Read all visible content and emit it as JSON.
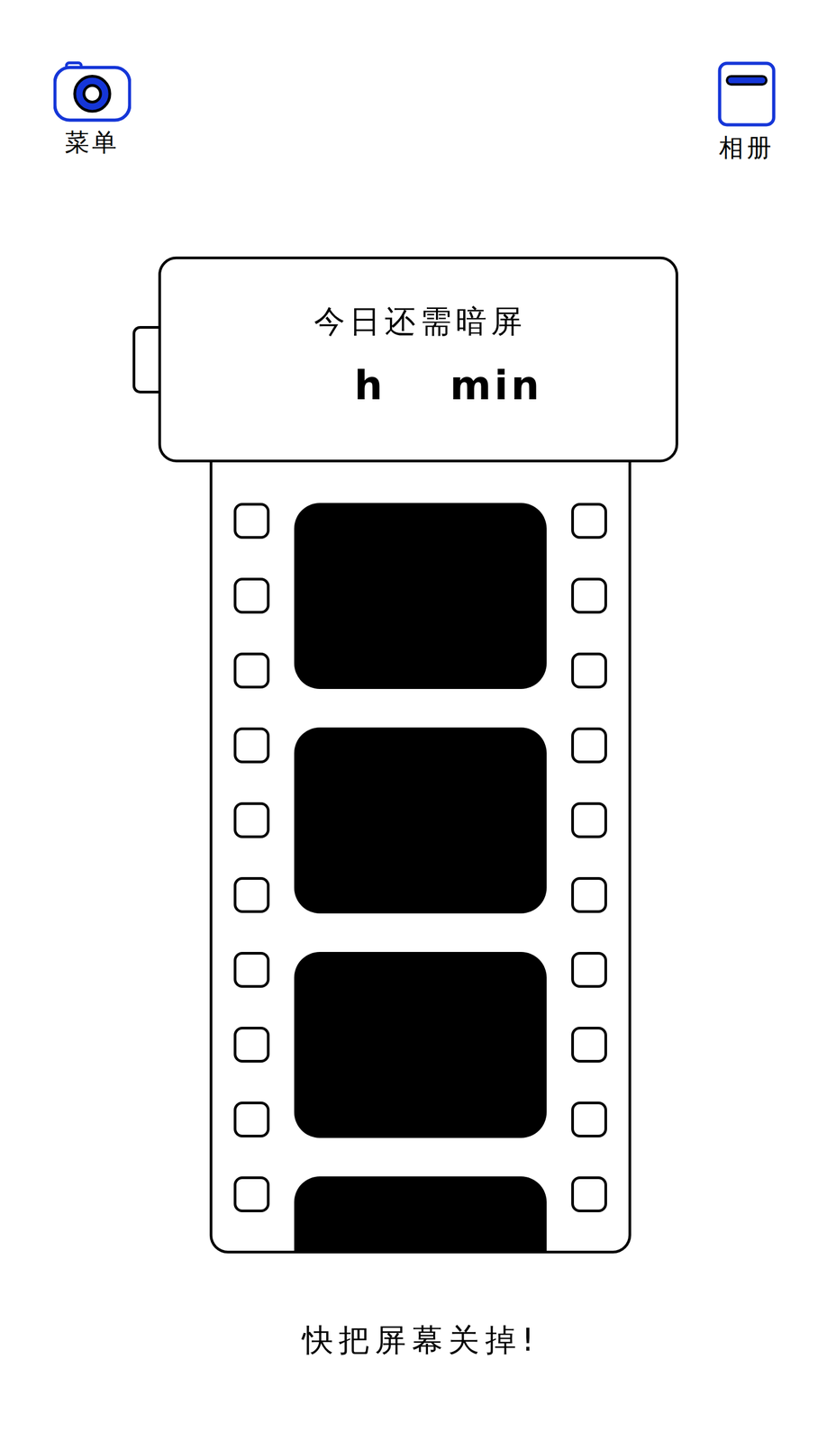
{
  "menu": {
    "label": "菜单"
  },
  "album": {
    "label": "相册"
  },
  "countdown": {
    "title": "今日还需暗屏",
    "hours_unit": "h",
    "minutes_unit": "min"
  },
  "footer": {
    "text": "快把屏幕关掉!"
  }
}
